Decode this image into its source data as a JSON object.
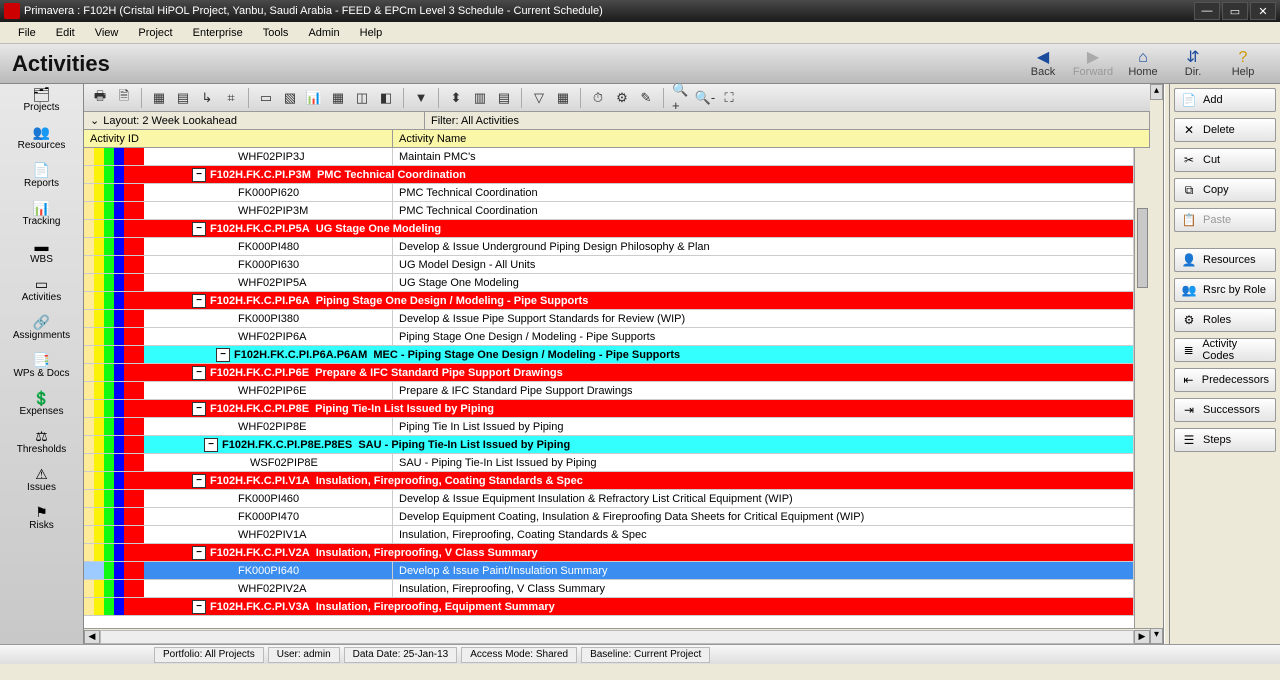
{
  "window": {
    "title": "Primavera : F102H (Cristal HiPOL Project, Yanbu, Saudi Arabia - FEED & EPCm Level 3 Schedule - Current Schedule)"
  },
  "menu": [
    "File",
    "Edit",
    "View",
    "Project",
    "Enterprise",
    "Tools",
    "Admin",
    "Help"
  ],
  "page_title": "Activities",
  "nav": {
    "back": "Back",
    "forward": "Forward",
    "home": "Home",
    "dir": "Dir.",
    "help": "Help"
  },
  "sidebar": [
    {
      "label": "Projects",
      "icon": "🗂"
    },
    {
      "label": "Resources",
      "icon": "👥"
    },
    {
      "label": "Reports",
      "icon": "📄"
    },
    {
      "label": "Tracking",
      "icon": "📊"
    },
    {
      "label": "WBS",
      "icon": "▬"
    },
    {
      "label": "Activities",
      "icon": "▭"
    },
    {
      "label": "Assignments",
      "icon": "🔗"
    },
    {
      "label": "WPs & Docs",
      "icon": "📑"
    },
    {
      "label": "Expenses",
      "icon": "💲"
    },
    {
      "label": "Thresholds",
      "icon": "⚖"
    },
    {
      "label": "Issues",
      "icon": "⚠"
    },
    {
      "label": "Risks",
      "icon": "⚑"
    }
  ],
  "layout": {
    "label": "Layout: 2 Week Lookahead",
    "filter": "Filter: All Activities"
  },
  "columns": {
    "id": "Activity ID",
    "name": "Activity Name"
  },
  "bar_colors": {
    "pale": "#feeb9a",
    "yellow": "#fbf20a",
    "green": "#12f912",
    "blue": "#0303fd",
    "red": "#f00",
    "cyan": "#3ff"
  },
  "rows": [
    {
      "type": "act",
      "indent": 6,
      "id": "WHF02PIP3J",
      "name": "Maintain PMC's"
    },
    {
      "type": "wbs",
      "style": "red",
      "indent": 4,
      "id": "F102H.FK.C.PI.P3M",
      "name": "PMC Technical Coordination"
    },
    {
      "type": "act",
      "indent": 6,
      "id": "FK000PI620",
      "name": "PMC Technical Coordination"
    },
    {
      "type": "act",
      "indent": 6,
      "id": "WHF02PIP3M",
      "name": "PMC Technical Coordination"
    },
    {
      "type": "wbs",
      "style": "red",
      "indent": 4,
      "id": "F102H.FK.C.PI.P5A",
      "name": "UG Stage One Modeling"
    },
    {
      "type": "act",
      "indent": 6,
      "id": "FK000PI480",
      "name": "Develop & Issue Underground Piping Design Philosophy & Plan"
    },
    {
      "type": "act",
      "indent": 6,
      "id": "FK000PI630",
      "name": "UG Model Design - All Units"
    },
    {
      "type": "act",
      "indent": 6,
      "id": "WHF02PIP5A",
      "name": "UG Stage One Modeling"
    },
    {
      "type": "wbs",
      "style": "red",
      "indent": 4,
      "id": "F102H.FK.C.PI.P6A",
      "name": "Piping Stage One Design / Modeling - Pipe Supports"
    },
    {
      "type": "act",
      "indent": 6,
      "id": "FK000PI380",
      "name": "Develop & Issue Pipe Support Standards for Review (WIP)"
    },
    {
      "type": "act",
      "indent": 6,
      "id": "WHF02PIP6A",
      "name": "Piping Stage One Design / Modeling - Pipe Supports"
    },
    {
      "type": "wbs",
      "style": "cyan",
      "indent": 6,
      "id": "F102H.FK.C.PI.P6A.P6AM",
      "name": "MEC - Piping Stage One Design / Modeling - Pipe Supports"
    },
    {
      "type": "wbs",
      "style": "red",
      "indent": 4,
      "id": "F102H.FK.C.PI.P6E",
      "name": "Prepare & IFC Standard Pipe Support Drawings"
    },
    {
      "type": "act",
      "indent": 6,
      "id": "WHF02PIP6E",
      "name": "Prepare & IFC Standard Pipe Support Drawings"
    },
    {
      "type": "wbs",
      "style": "red",
      "indent": 4,
      "id": "F102H.FK.C.PI.P8E",
      "name": "Piping Tie-In List Issued by Piping"
    },
    {
      "type": "act",
      "indent": 6,
      "id": "WHF02PIP8E",
      "name": "Piping Tie In List Issued by Piping"
    },
    {
      "type": "wbs",
      "style": "cyan",
      "indent": 5,
      "id": "F102H.FK.C.PI.P8E.P8ES",
      "name": "SAU - Piping Tie-In List Issued by Piping"
    },
    {
      "type": "act",
      "indent": 7,
      "id": "WSF02PIP8E",
      "name": "SAU - Piping Tie-In List Issued by Piping"
    },
    {
      "type": "wbs",
      "style": "red",
      "indent": 4,
      "id": "F102H.FK.C.PI.V1A",
      "name": "Insulation, Fireproofing, Coating Standards & Spec"
    },
    {
      "type": "act",
      "indent": 6,
      "id": "FK000PI460",
      "name": "Develop & Issue Equipment Insulation & Refractory List Critical Equipment (WIP)"
    },
    {
      "type": "act",
      "indent": 6,
      "id": "FK000PI470",
      "name": "Develop Equipment Coating, Insulation & Fireproofing Data Sheets for Critical Equipment (WIP)"
    },
    {
      "type": "act",
      "indent": 6,
      "id": "WHF02PIV1A",
      "name": "Insulation, Fireproofing, Coating Standards & Spec"
    },
    {
      "type": "wbs",
      "style": "red",
      "indent": 4,
      "id": "F102H.FK.C.PI.V2A",
      "name": "Insulation, Fireproofing, V Class Summary"
    },
    {
      "type": "act",
      "indent": 6,
      "id": "FK000PI640",
      "name": "Develop & Issue Paint/Insulation Summary",
      "selected": true,
      "hl": true
    },
    {
      "type": "act",
      "indent": 6,
      "id": "WHF02PIV2A",
      "name": "Insulation, Fireproofing, V Class Summary"
    },
    {
      "type": "wbs",
      "style": "red",
      "indent": 4,
      "id": "F102H.FK.C.PI.V3A",
      "name": "Insulation, Fireproofing, Equipment Summary"
    }
  ],
  "rpanel": [
    {
      "icon": "📄",
      "label": "Add"
    },
    {
      "icon": "✕",
      "label": "Delete"
    },
    {
      "icon": "✂",
      "label": "Cut"
    },
    {
      "icon": "⧉",
      "label": "Copy"
    },
    {
      "icon": "📋",
      "label": "Paste",
      "disabled": true
    },
    {
      "sep": true
    },
    {
      "icon": "👤",
      "label": "Resources"
    },
    {
      "icon": "👥",
      "label": "Rsrc by Role"
    },
    {
      "icon": "⚙",
      "label": "Roles"
    },
    {
      "icon": "≣",
      "label": "Activity Codes"
    },
    {
      "icon": "⇤",
      "label": "Predecessors"
    },
    {
      "icon": "⇥",
      "label": "Successors"
    },
    {
      "icon": "☰",
      "label": "Steps"
    }
  ],
  "status": {
    "portfolio": "Portfolio: All Projects",
    "user": "User: admin",
    "date": "Data Date: 25-Jan-13",
    "access": "Access Mode: Shared",
    "baseline": "Baseline: Current Project"
  }
}
